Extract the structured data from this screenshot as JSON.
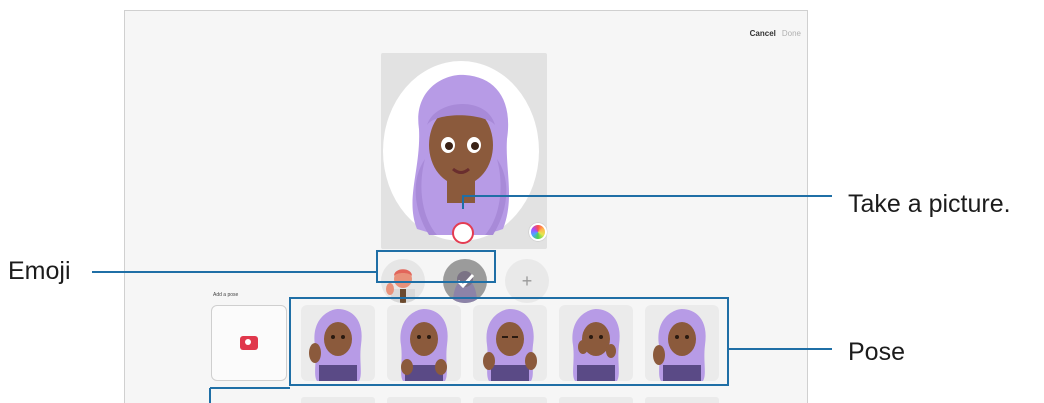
{
  "header": {
    "cancel_label": "Cancel",
    "done_label": "Done"
  },
  "pose_section": {
    "label": "Add a pose"
  },
  "emoji_row": {
    "add_symbol": "+"
  },
  "callouts": {
    "take_picture": "Take a picture.",
    "emoji": "Emoji",
    "pose": "Pose"
  },
  "icons": [
    "camera-icon",
    "color-wheel-icon",
    "plus-icon",
    "check-icon"
  ],
  "colors": {
    "capture_ring": "#e43c52",
    "callout_line": "#1f6fa6",
    "hair": "#b79be6",
    "shirt": "#5a4a86"
  }
}
